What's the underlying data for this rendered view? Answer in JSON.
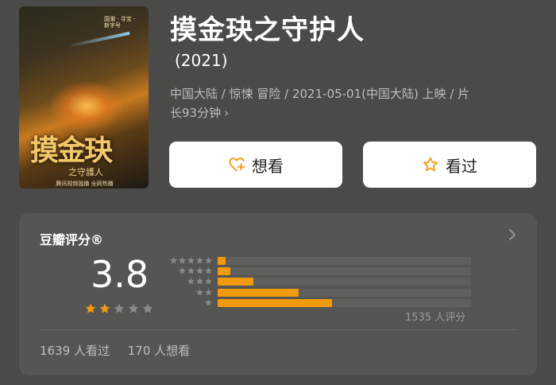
{
  "movie": {
    "title": "摸金玦之守护人",
    "year": "(2021)",
    "meta_line1": "中国大陆 / 惊悚 冒险 / 2021-05-01(中国大陆) 上映 / 片",
    "meta_line2": "长93分钟",
    "more_glyph": "›"
  },
  "poster": {
    "title_text": "摸金玦",
    "subtitle_text": "之守護人",
    "footer_text": "腾讯视频独播 全网热播",
    "side_text": "国潮 · 寻宝 · 新字号"
  },
  "actions": {
    "want_label": "想看",
    "seen_label": "看过",
    "want_icon": "heart-plus-icon",
    "seen_icon": "star-outline-icon"
  },
  "rating": {
    "source_label": "豆瓣评分®",
    "score": "3.8",
    "stars_filled": 2,
    "stars_total": 5,
    "distribution": [
      {
        "stars": 5,
        "fraction": 0.03
      },
      {
        "stars": 4,
        "fraction": 0.05
      },
      {
        "stars": 3,
        "fraction": 0.14
      },
      {
        "stars": 2,
        "fraction": 0.32
      },
      {
        "stars": 1,
        "fraction": 0.45
      }
    ],
    "rating_count": "1535 人评分",
    "seen_count": "1639 人看过",
    "want_count": "170 人想看"
  },
  "colors": {
    "accent": "#f19a0e",
    "star_filled": "#f19a0e",
    "star_empty": "#8a8a89",
    "background": "#4a4a49",
    "card": "#555554"
  }
}
